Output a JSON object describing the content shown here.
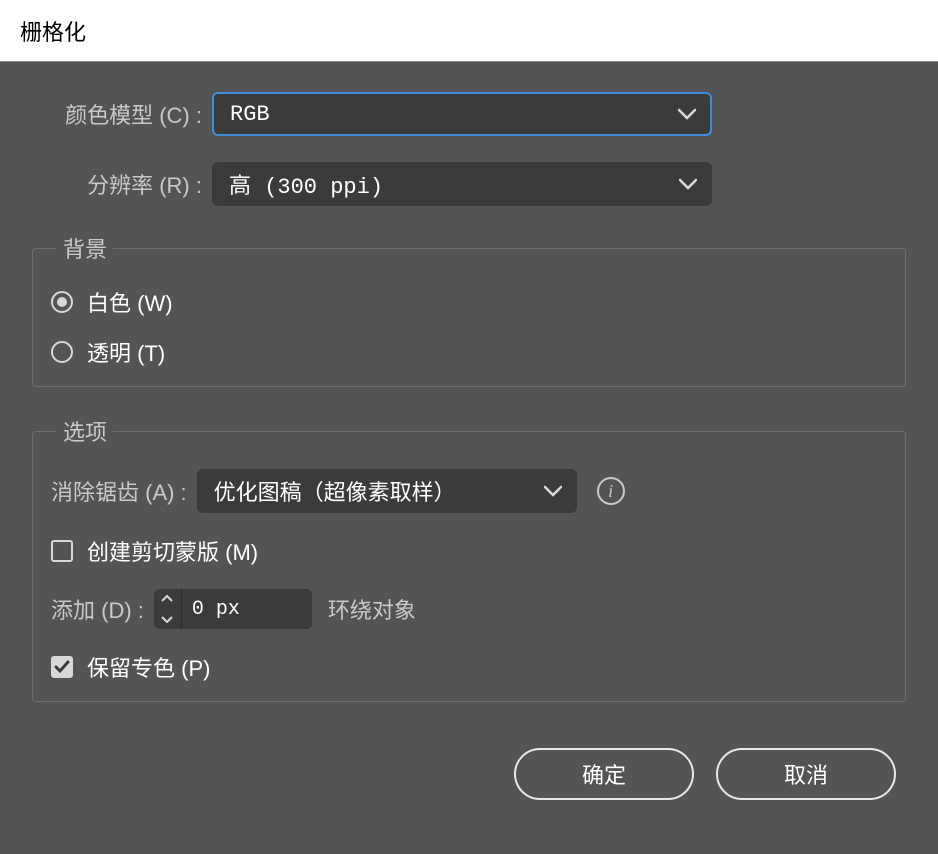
{
  "title": "栅格化",
  "colorModel": {
    "label": "颜色模型 (C) :",
    "value": "RGB"
  },
  "resolution": {
    "label": "分辨率 (R) :",
    "value": "高 (300 ppi)"
  },
  "background": {
    "legend": "背景",
    "white": {
      "label": "白色 (W)",
      "selected": true
    },
    "transparent": {
      "label": "透明 (T)",
      "selected": false
    }
  },
  "options": {
    "legend": "选项",
    "antialias": {
      "label": "消除锯齿 (A) :",
      "value": "优化图稿（超像素取样）"
    },
    "clipMask": {
      "label": "创建剪切蒙版 (M)",
      "checked": false
    },
    "add": {
      "label": "添加 (D) :",
      "value": "0 px",
      "suffix": "环绕对象"
    },
    "spot": {
      "label": "保留专色 (P)",
      "checked": true
    }
  },
  "buttons": {
    "ok": "确定",
    "cancel": "取消"
  }
}
